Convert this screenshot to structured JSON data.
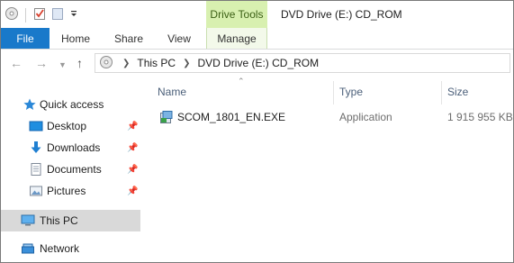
{
  "titlebar": {
    "contextual_tab": "Drive Tools",
    "title": "DVD Drive (E:) CD_ROM"
  },
  "ribbon": {
    "tabs": [
      "File",
      "Home",
      "Share",
      "View",
      "Manage"
    ]
  },
  "address": {
    "crumbs": [
      "This PC",
      "DVD Drive (E:) CD_ROM"
    ]
  },
  "nav": {
    "items": [
      {
        "label": "Quick access",
        "icon": "star-icon"
      },
      {
        "label": "Desktop",
        "icon": "desktop-icon",
        "pinned": true
      },
      {
        "label": "Downloads",
        "icon": "download-icon",
        "pinned": true
      },
      {
        "label": "Documents",
        "icon": "documents-icon",
        "pinned": true
      },
      {
        "label": "Pictures",
        "icon": "pictures-icon",
        "pinned": true
      },
      {
        "label": "This PC",
        "icon": "computer-icon",
        "selected": true
      },
      {
        "label": "Network",
        "icon": "network-icon"
      }
    ]
  },
  "columns": {
    "name": "Name",
    "type": "Type",
    "size": "Size"
  },
  "files": [
    {
      "name": "SCOM_1801_EN.EXE",
      "type": "Application",
      "size": "1 915 955 KB",
      "icon": "setup-exe-icon"
    }
  ],
  "colors": {
    "file_tab": "#1979ca",
    "drive_tools_bg": "#d8f0b0",
    "selected_nav": "#d9d9d9",
    "header_text": "#4c607a"
  }
}
